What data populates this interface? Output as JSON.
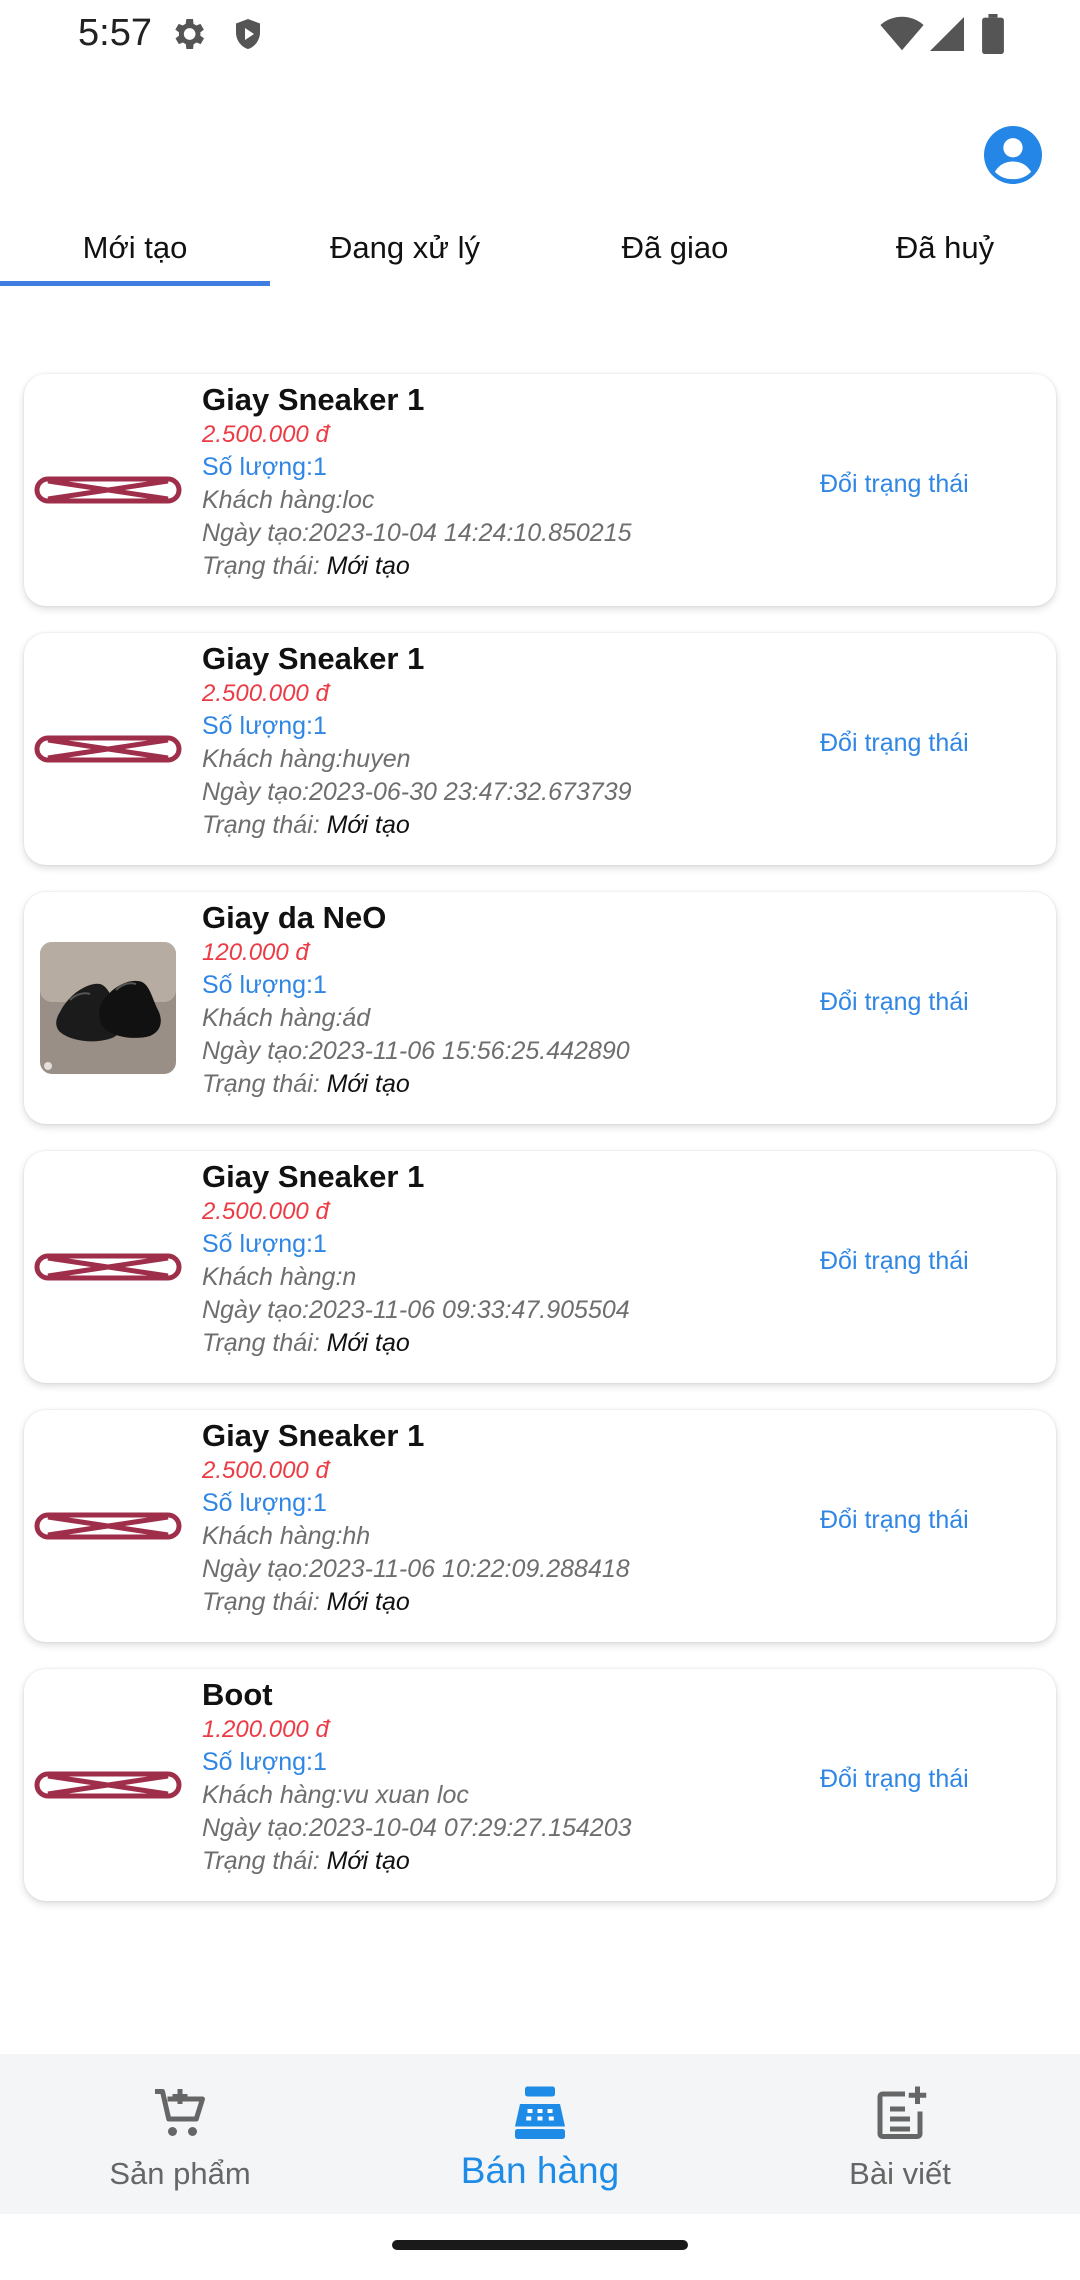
{
  "status": {
    "time": "5:57"
  },
  "tabs": [
    {
      "label": "Mới tạo",
      "active": true
    },
    {
      "label": "Đang xử lý",
      "active": false
    },
    {
      "label": "Đã giao",
      "active": false
    },
    {
      "label": "Đã huỷ",
      "active": false
    }
  ],
  "colors": {
    "accent": "#3f7ee0",
    "price": "#ec3b45",
    "link": "#2f86e4",
    "thumb_cross": "#9e2e4a"
  },
  "orders": [
    {
      "name": "Giay Sneaker 1",
      "price": "2.500.000 đ",
      "qty": "Số lượng:1",
      "customer": "Khách hàng:loc",
      "date": "Ngày tạo:2023-10-04 14:24:10.850215",
      "status_label": "Trạng thái:",
      "status_value": "Mới tạo",
      "action": "Đổi trạng thái",
      "thumb_icon": "broken-image-icon"
    },
    {
      "name": "Giay Sneaker 1",
      "price": "2.500.000 đ",
      "qty": "Số lượng:1",
      "customer": "Khách hàng:huyen",
      "date": "Ngày tạo:2023-06-30 23:47:32.673739",
      "status_label": "Trạng thái:",
      "status_value": "Mới tạo",
      "action": "Đổi trạng thái",
      "thumb_icon": "broken-image-icon"
    },
    {
      "name": "Giay da NeO",
      "price": "120.000 đ",
      "qty": "Số lượng:1",
      "customer": "Khách hàng:ád",
      "date": "Ngày tạo:2023-11-06 15:56:25.442890",
      "status_label": "Trạng thái:",
      "status_value": "Mới tạo",
      "action": "Đổi trạng thái",
      "thumb_icon": "leather-shoes-photo"
    },
    {
      "name": "Giay Sneaker 1",
      "price": "2.500.000 đ",
      "qty": "Số lượng:1",
      "customer": "Khách hàng:n",
      "date": "Ngày tạo:2023-11-06 09:33:47.905504",
      "status_label": "Trạng thái:",
      "status_value": "Mới tạo",
      "action": "Đổi trạng thái",
      "thumb_icon": "broken-image-icon"
    },
    {
      "name": "Giay Sneaker 1",
      "price": "2.500.000 đ",
      "qty": "Số lượng:1",
      "customer": "Khách hàng:hh",
      "date": "Ngày tạo:2023-11-06 10:22:09.288418",
      "status_label": "Trạng thái:",
      "status_value": "Mới tạo",
      "action": "Đổi trạng thái",
      "thumb_icon": "broken-image-icon"
    },
    {
      "name": "Boot",
      "price": "1.200.000 đ",
      "qty": "Số lượng:1",
      "customer": "Khách hàng:vu xuan loc",
      "date": "Ngày tạo:2023-10-04 07:29:27.154203",
      "status_label": "Trạng thái:",
      "status_value": "Mới tạo",
      "action": "Đổi trạng thái",
      "thumb_icon": "broken-image-icon"
    }
  ],
  "bottom_nav": [
    {
      "label": "Sản phẩm",
      "icon": "cart-icon",
      "active": false
    },
    {
      "label": "Bán hàng",
      "icon": "cash-register-icon",
      "active": true
    },
    {
      "label": "Bài viết",
      "icon": "post-add-icon",
      "active": false
    }
  ]
}
